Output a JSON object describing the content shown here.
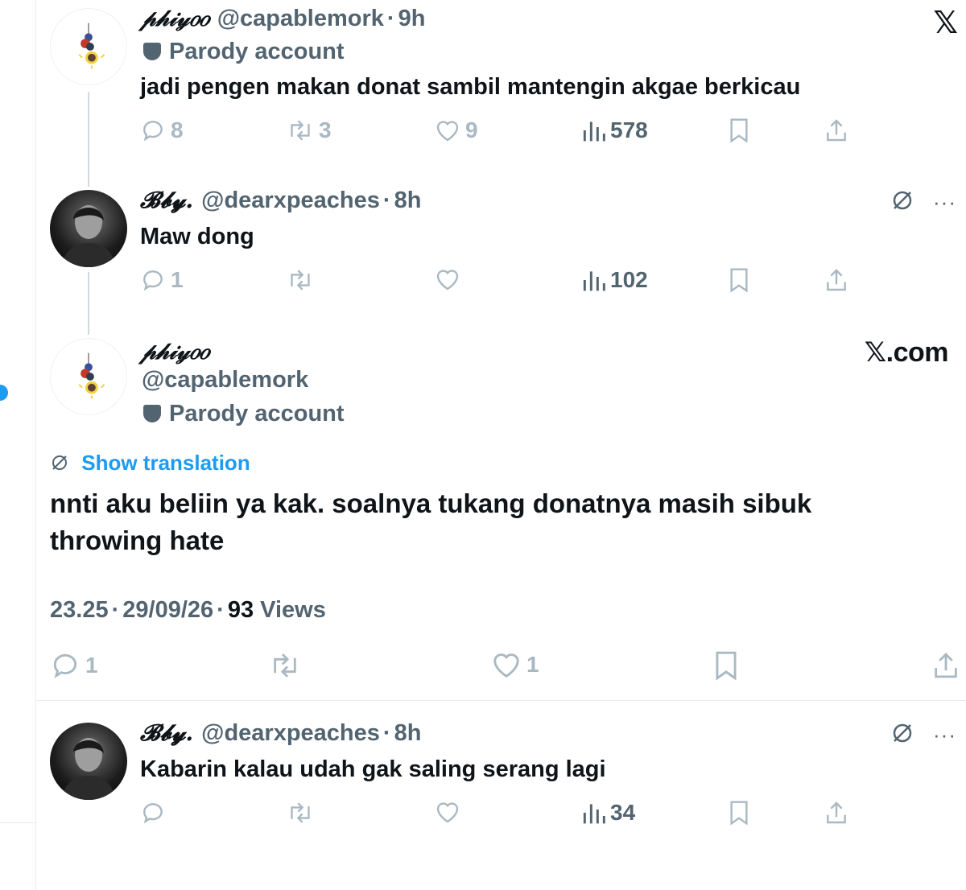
{
  "app": {
    "logo_glyph": "𝕏",
    "watermark": "𝕏.com"
  },
  "tweet1": {
    "display_name": "𝓅𝒽𝒾𝓎𝑜𝑜",
    "handle": "@capablemork",
    "time": "9h",
    "badge": "Parody account",
    "text": "jadi pengen makan donat sambil mantengin akgae berkicau",
    "replies": "8",
    "retweets": "3",
    "likes": "9",
    "views": "578"
  },
  "tweet2": {
    "display_name": "𝓑𝓫𝔂.",
    "handle": "@dearxpeaches",
    "time": "8h",
    "text": "Maw dong",
    "replies": "1",
    "retweets": "",
    "likes": "",
    "views": "102",
    "more": "···"
  },
  "main_tweet": {
    "display_name": "𝓅𝒽𝒾𝓎𝑜𝑜",
    "handle": "@capablemork",
    "badge": "Parody account",
    "show_translation": "Show translation",
    "text": "nnti aku beliin ya kak. soalnya tukang donatnya masih sibuk throwing hate",
    "time": "23.25",
    "date": "29/09/26",
    "views_count": "93",
    "views_label": "Views",
    "replies": "1",
    "likes": "1"
  },
  "tweet3": {
    "display_name": "𝓑𝓫𝔂.",
    "handle": "@dearxpeaches",
    "time": "8h",
    "text": "Kabarin kalau udah gak saling serang lagi",
    "views": "34",
    "more": "···"
  },
  "colors": {
    "accent": "#1d9bf0",
    "muted": "#536471",
    "icon_light": "#aab8c2",
    "text": "#0f1419"
  }
}
